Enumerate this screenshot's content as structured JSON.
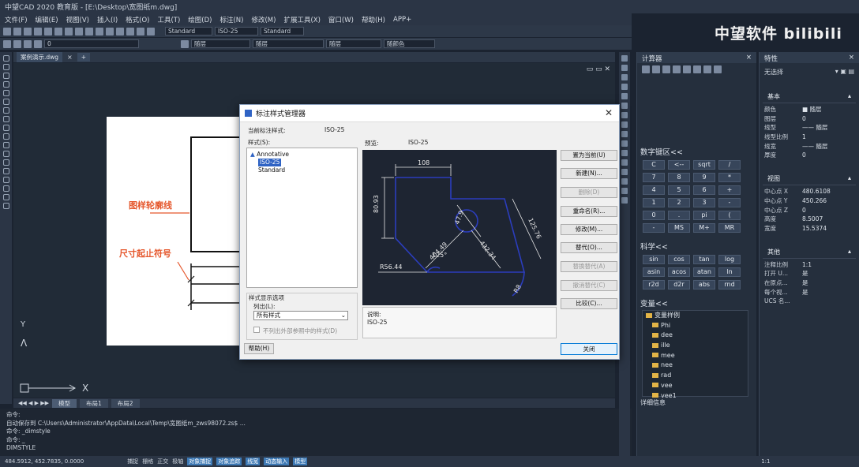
{
  "window": {
    "title": "中望CAD 2020 教育版 - [E:\\Desktop\\宽图纸m.dwg]"
  },
  "menu": [
    "文件(F)",
    "编辑(E)",
    "视图(V)",
    "插入(I)",
    "格式(O)",
    "工具(T)",
    "绘图(D)",
    "标注(N)",
    "修改(M)",
    "扩展工具(X)",
    "窗口(W)",
    "帮助(H)",
    "APP+"
  ],
  "toolbar": {
    "layer_combo": "0",
    "linetype_combo": "随层",
    "lineweight_combo": "随层",
    "color_combo": "随颜色",
    "dimstyle_combo": "ISO-25",
    "textstyle_combo": "Standard",
    "scale_combo": "Standard"
  },
  "doc_tabs": [
    "案例演示.dwg",
    "+"
  ],
  "annotations": {
    "frame_line": "图样轮廓线",
    "dim_terminator": "尺寸起止符号"
  },
  "layout_tabs": [
    "模型",
    "布局1",
    "布局2"
  ],
  "command_lines": [
    "命令:",
    "自动保存到 C:\\Users\\Administrator\\AppData\\Local\\Temp\\宽图纸m_zws98072.zs$ ...",
    "命令: _dimstyle",
    "命令: _",
    "DIMSTYLE"
  ],
  "statusbar": {
    "coords": "484.5912, 452.7835, 0.0000",
    "toggles": [
      "捕捉",
      "栅格",
      "正交",
      "极轴",
      "对象捕捉",
      "对象追踪",
      "线宽",
      "动态输入",
      "模型"
    ],
    "right": "1:1"
  },
  "logo": "中望软件 bilibili",
  "calc": {
    "panel_title": "计算器",
    "numpad_title": "数字键区<<",
    "numpad_keys": [
      "C",
      "<--",
      "sqrt",
      "/",
      "7",
      "8",
      "9",
      "*",
      "4",
      "5",
      "6",
      "+",
      "1",
      "2",
      "3",
      "-",
      "0",
      ".",
      "pi",
      "(",
      "-",
      "MS",
      "M+",
      "MR"
    ],
    "sci_title": "科学<<",
    "sci_keys": [
      "sin",
      "cos",
      "tan",
      "log",
      "asin",
      "acos",
      "atan",
      "ln",
      "r2d",
      "d2r",
      "abs",
      "rnd"
    ],
    "var_title": "变量<<",
    "var_root": "变量样例",
    "vars": [
      "Phi",
      "dee",
      "ille",
      "mee",
      "nee",
      "rad",
      "vee",
      "vee1"
    ],
    "details": "详细信息"
  },
  "props": {
    "title": "特性",
    "selection": "无选择",
    "basic": {
      "title": "基本",
      "rows": [
        [
          "颜色",
          "■ 随层"
        ],
        [
          "图层",
          "0"
        ],
        [
          "线型",
          "—— 随层"
        ],
        [
          "线型比例",
          "1"
        ],
        [
          "线宽",
          "—— 随层"
        ],
        [
          "厚度",
          "0"
        ]
      ]
    },
    "view": {
      "title": "视图",
      "rows": [
        [
          "中心点 X",
          "480.6108"
        ],
        [
          "中心点 Y",
          "450.266"
        ],
        [
          "中心点 Z",
          "0"
        ],
        [
          "高度",
          "8.5007"
        ],
        [
          "宽度",
          "15.5374"
        ]
      ]
    },
    "misc": {
      "title": "其他",
      "rows": [
        [
          "注释比例",
          "1:1"
        ],
        [
          "打开 U...",
          "是"
        ],
        [
          "在原点...",
          "是"
        ],
        [
          "每个视...",
          "是"
        ],
        [
          "UCS 名...",
          ""
        ]
      ]
    }
  },
  "dialog": {
    "title": "标注样式管理器",
    "current_style_label": "当前标注样式:",
    "current_style": "ISO-25",
    "styles_label": "样式(S):",
    "styles": [
      "Annotative",
      "ISO-25",
      "Standard"
    ],
    "preview_label": "预览:",
    "preview_style": "ISO-25",
    "list_label": "列出(L):",
    "list_options_title": "样式显示选项",
    "list_value": "所有样式",
    "checkbox_label": "不列出外部参照中的样式(D)",
    "desc_label": "说明:",
    "desc_value": "ISO-25",
    "buttons": [
      "置为当前(U)",
      "新建(N)...",
      "删除(D)",
      "重命名(R)...",
      "修改(M)...",
      "替代(O)...",
      "替换替代(A)",
      "撤消替代(C)",
      "比较(C)..."
    ],
    "help": "帮助(H)",
    "close": "关闭",
    "preview_dims": {
      "top": "108",
      "left": "80.93",
      "right": "125.76",
      "diag1": "404.49",
      "diag2": "432.34",
      "angle": "125°",
      "radius": "R56.44",
      "small": "47.9",
      "r2": "R8"
    }
  }
}
